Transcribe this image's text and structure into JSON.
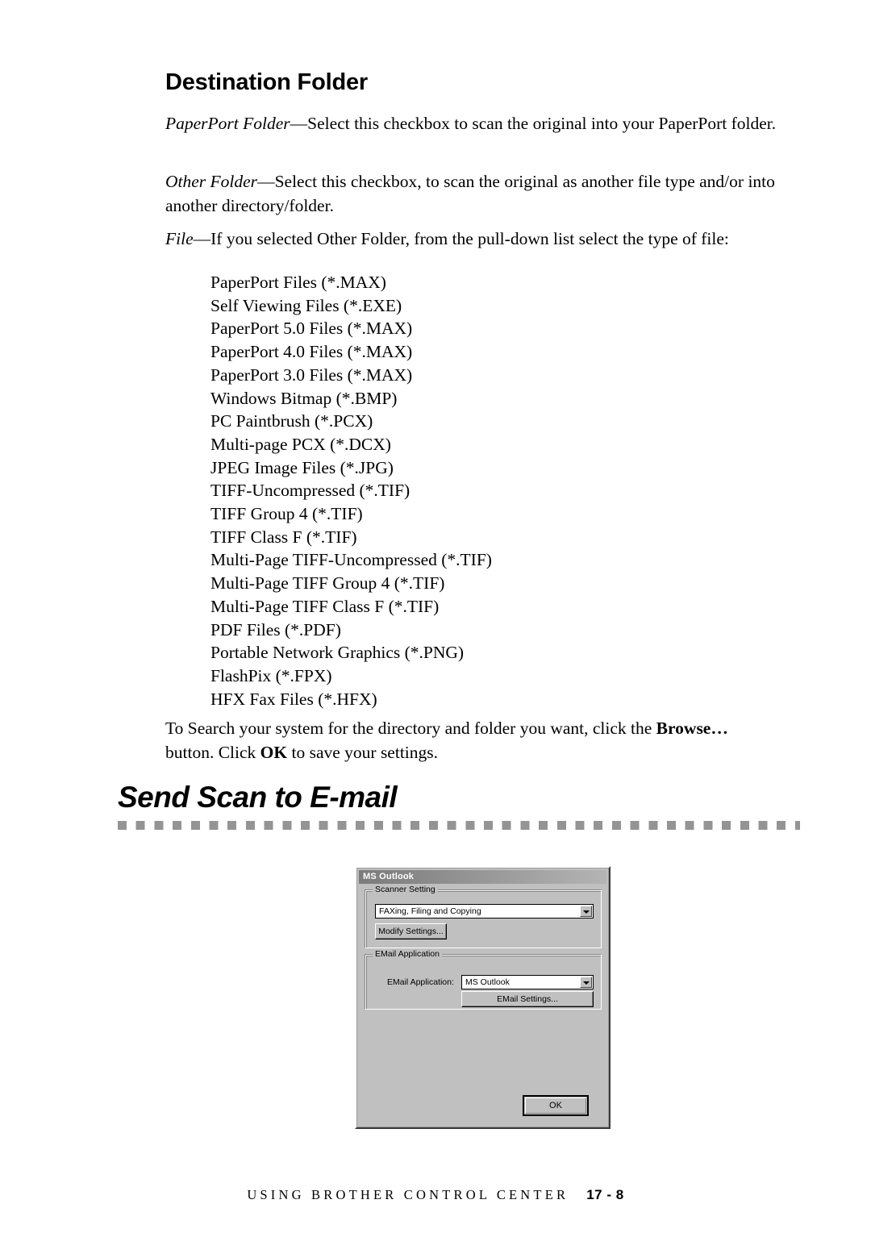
{
  "document": {
    "section_heading": "Destination Folder",
    "chapter_heading": "Send Scan to E-mail",
    "paragraphs": {
      "paperport_folder_label": "PaperPort Folder",
      "paperport_folder_text": "—Select this checkbox to scan the original into your PaperPort folder.",
      "other_folder_label": "Other Folder",
      "other_folder_text": "—Select this checkbox, to scan the original as another file type and/or into another directory/folder.",
      "file_label": "File",
      "file_text": "—If you selected Other Folder, from the pull-down list select the type of file:",
      "browse_intro": "To Search your system for the directory and folder you want, click the ",
      "browse_bold": "Browse…",
      "browse_middle": " button. Click ",
      "ok_bold": "OK",
      "browse_end": " to save your settings."
    },
    "file_types": [
      "PaperPort Files (*.MAX)",
      "Self Viewing Files (*.EXE)",
      "PaperPort 5.0 Files (*.MAX)",
      "PaperPort 4.0 Files (*.MAX)",
      "PaperPort 3.0 Files (*.MAX)",
      "Windows Bitmap (*.BMP)",
      "PC Paintbrush (*.PCX)",
      "Multi-page PCX (*.DCX)",
      "JPEG Image Files (*.JPG)",
      "TIFF-Uncompressed (*.TIF)",
      "TIFF Group 4 (*.TIF)",
      "TIFF Class F (*.TIF)",
      "Multi-Page TIFF-Uncompressed (*.TIF)",
      "Multi-Page TIFF Group 4 (*.TIF)",
      "Multi-Page TIFF Class F (*.TIF)",
      "PDF Files (*.PDF)",
      "Portable Network Graphics (*.PNG)",
      "FlashPix (*.FPX)",
      "HFX Fax Files (*.HFX)"
    ],
    "footer": {
      "title": "USING BROTHER CONTROL CENTER",
      "page": "17 - 8"
    }
  },
  "dialog": {
    "title": "MS Outlook",
    "scanner_group": {
      "legend": "Scanner Setting",
      "profile_value": "FAXing, Filing and Copying",
      "modify_button": "Modify Settings..."
    },
    "email_group": {
      "legend": "EMail Application",
      "field_label": "EMail Application:",
      "application_value": "MS Outlook",
      "settings_button": "EMail Settings..."
    },
    "ok_button": "OK"
  },
  "colors": {
    "dialog_face": "#c0c0c0",
    "titlebar_dark": "#7b7b7b",
    "rule_square": "#949494",
    "text": "#000000"
  }
}
